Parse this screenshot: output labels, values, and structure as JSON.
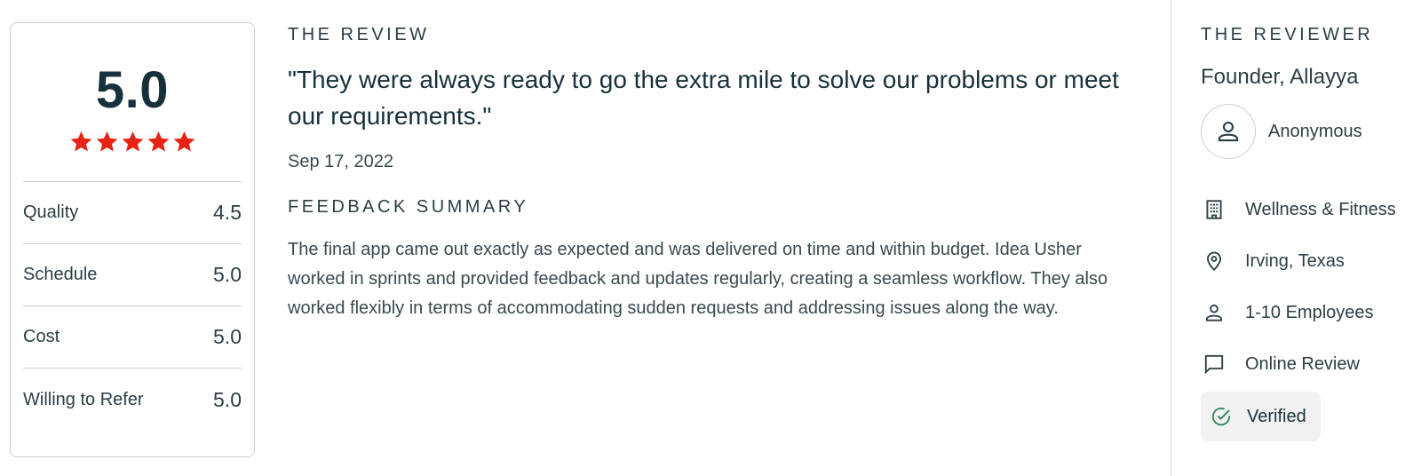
{
  "rating": {
    "overall": "5.0",
    "stars": 5,
    "star_color": "#e62415",
    "metrics": [
      {
        "label": "Quality",
        "value": "4.5"
      },
      {
        "label": "Schedule",
        "value": "5.0"
      },
      {
        "label": "Cost",
        "value": "5.0"
      },
      {
        "label": "Willing to Refer",
        "value": "5.0"
      }
    ]
  },
  "review": {
    "heading": "THE REVIEW",
    "quote": "\"They were always ready to go the extra mile to solve our problems or meet our requirements.\"",
    "date": "Sep 17, 2022",
    "feedback_heading": "FEEDBACK SUMMARY",
    "summary": "The final app came out exactly as expected and was delivered on time and within budget. Idea Usher worked in sprints and provided feedback and updates regularly, creating a seamless workflow. They also worked flexibly in terms of accommodating sudden requests and addressing issues along the way."
  },
  "reviewer": {
    "heading": "THE REVIEWER",
    "title": "Founder, Allayya",
    "name": "Anonymous",
    "avatar_icon": "person-icon",
    "details": [
      {
        "icon": "building-icon",
        "text": "Wellness & Fitness"
      },
      {
        "icon": "location-pin-icon",
        "text": "Irving, Texas"
      },
      {
        "icon": "person-icon",
        "text": "1-10 Employees"
      },
      {
        "icon": "chat-bubble-icon",
        "text": "Online Review"
      }
    ],
    "verified": {
      "icon": "check-circle-icon",
      "text": "Verified",
      "color": "#2e8b57"
    }
  }
}
